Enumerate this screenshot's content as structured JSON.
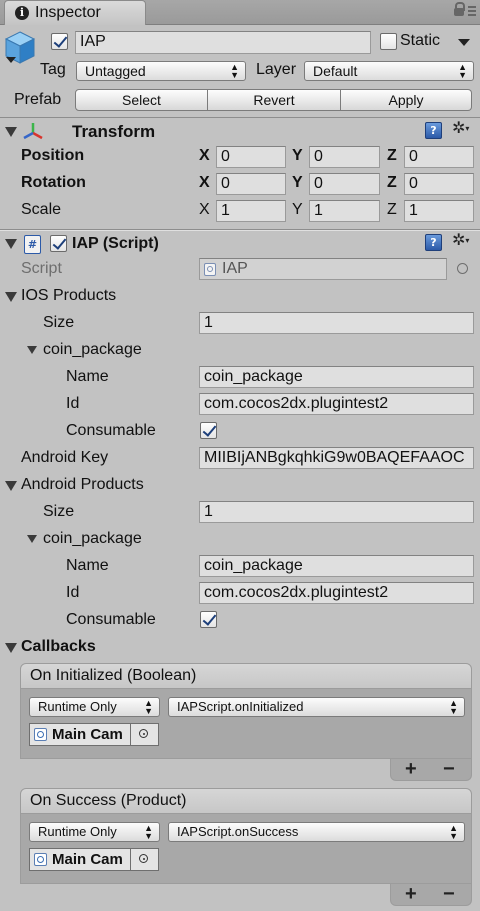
{
  "tab": {
    "title": "Inspector"
  },
  "header": {
    "object_name": "IAP",
    "active": true,
    "static_label": "Static",
    "static_checked": false,
    "tag_label": "Tag",
    "tag_value": "Untagged",
    "layer_label": "Layer",
    "layer_value": "Default",
    "prefab_label": "Prefab",
    "prefab_buttons": [
      "Select",
      "Revert",
      "Apply"
    ]
  },
  "transform": {
    "title": "Transform",
    "rows": [
      {
        "label": "Position",
        "x": "0",
        "y": "0",
        "z": "0"
      },
      {
        "label": "Rotation",
        "x": "0",
        "y": "0",
        "z": "0"
      },
      {
        "label": "Scale",
        "x": "1",
        "y": "1",
        "z": "1"
      }
    ],
    "axis": [
      "X",
      "Y",
      "Z"
    ]
  },
  "script_component": {
    "title": "IAP (Script)",
    "enabled": true,
    "script_label": "Script",
    "script_value": "IAP",
    "ios_products_label": "IOS Products",
    "ios": {
      "size_label": "Size",
      "size_value": "1",
      "item_label": "coin_package",
      "name_label": "Name",
      "name_value": "coin_package",
      "id_label": "Id",
      "id_value": "com.cocos2dx.plugintest2",
      "consumable_label": "Consumable",
      "consumable": true
    },
    "android_key_label": "Android Key",
    "android_key_value": "MIIBIjANBgkqhkiG9w0BAQEFAAOC",
    "android_products_label": "Android Products",
    "android": {
      "size_label": "Size",
      "size_value": "1",
      "item_label": "coin_package",
      "name_label": "Name",
      "name_value": "coin_package",
      "id_label": "Id",
      "id_value": "com.cocos2dx.plugintest2",
      "consumable_label": "Consumable",
      "consumable": true
    },
    "callbacks_label": "Callbacks",
    "events": [
      {
        "title": "On Initialized (Boolean)",
        "mode": "Runtime Only",
        "function": "IAPScript.onInitialized",
        "object": "Main Cam"
      },
      {
        "title": "On Success (Product)",
        "mode": "Runtime Only",
        "function": "IAPScript.onSuccess",
        "object": "Main Cam"
      }
    ],
    "add_label": "+",
    "remove_label": "−"
  },
  "icons": {
    "tab_info": "i",
    "help": "?",
    "gear": "✲"
  }
}
